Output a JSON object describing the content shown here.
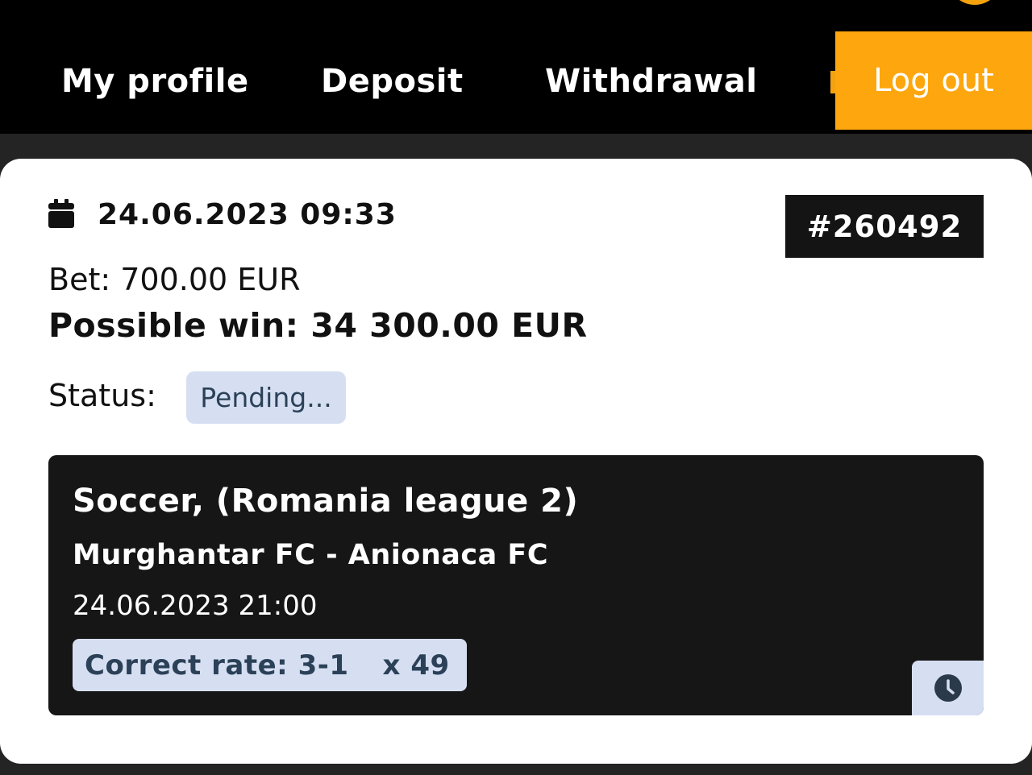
{
  "nav": {
    "items": [
      {
        "label": "My profile"
      },
      {
        "label": "Deposit"
      },
      {
        "label": "Withdrawal"
      }
    ],
    "logout_label": "Log out"
  },
  "bet": {
    "datetime": "24.06.2023 09:33",
    "ticket_id": "#260492",
    "bet_text": "Bet: 700.00 EUR",
    "possible_win_text": "Possible win: 34 300.00 EUR",
    "status_label": "Status:",
    "status_value": "Pending..."
  },
  "event": {
    "title": "Soccer, (Romania league 2)",
    "teams": "Murghantar FC - Anionaca FC",
    "time": "24.06.2023 21:00",
    "market": "Correct rate: 3-1",
    "odd": "x 49"
  },
  "icons": {
    "calendar": "calendar-icon",
    "clock": "clock-icon"
  },
  "colors": {
    "accent": "#fea60d",
    "background": "#242424",
    "badge": "#d6dff2",
    "badge_text": "#2b4158"
  }
}
